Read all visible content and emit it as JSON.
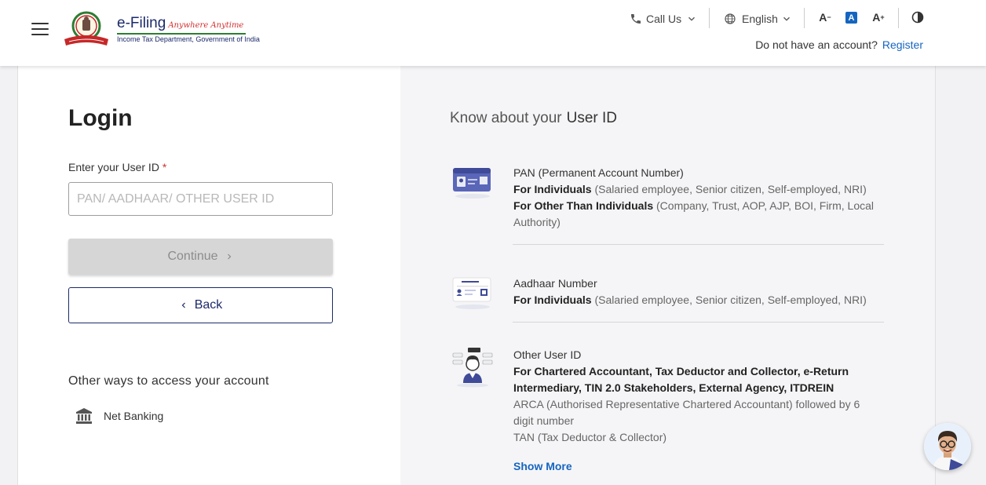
{
  "header": {
    "logo_title": "e-Filing",
    "logo_tagline": "Anywhere Anytime",
    "logo_subtitle": "Income Tax Department, Government of India",
    "call_us": "Call Us",
    "language": "English",
    "font_decrease": "A",
    "font_normal": "A",
    "font_increase": "A",
    "no_account": "Do not have an account?",
    "register": "Register"
  },
  "login": {
    "title": "Login",
    "user_id_label": "Enter your User ID",
    "required_mark": "*",
    "user_id_placeholder": "PAN/ AADHAAR/ OTHER USER ID",
    "continue": "Continue",
    "back": "Back",
    "other_ways": "Other ways to access your account",
    "net_banking": "Net Banking"
  },
  "know": {
    "title_prefix": "Know about your",
    "title_emph": "User ID",
    "pan": {
      "title": "PAN (Permanent Account Number)",
      "ind_label": "For Individuals",
      "ind_desc": "(Salaried employee, Senior citizen, Self-employed, NRI)",
      "other_label": "For Other Than Individuals",
      "other_desc": "(Company, Trust, AOP, AJP, BOI, Firm, Local Authority)"
    },
    "aadhaar": {
      "title": "Aadhaar Number",
      "ind_label": "For Individuals",
      "ind_desc": "(Salaried employee, Senior citizen, Self-employed, NRI)"
    },
    "other": {
      "title": "Other User ID",
      "bold": "For Chartered Accountant, Tax Deductor and Collector, e-Return Intermediary, TIN 2.0 Stakeholders, External Agency, ITDREIN",
      "arca": "ARCA (Authorised Representative Chartered Accountant) followed by 6 digit number",
      "tan": "TAN (Tax Deductor & Collector)",
      "show_more": "Show More"
    }
  },
  "icons": {
    "menu": "hamburger-icon",
    "phone": "phone-icon",
    "globe": "globe-icon",
    "contrast": "contrast-icon",
    "bank": "bank-icon",
    "chatbot": "chatbot-avatar"
  },
  "colors": {
    "primary_navy": "#1c2a6b",
    "link_blue": "#1565c0",
    "required_red": "#d32f2f",
    "disabled_grey": "#d6d6d6"
  }
}
